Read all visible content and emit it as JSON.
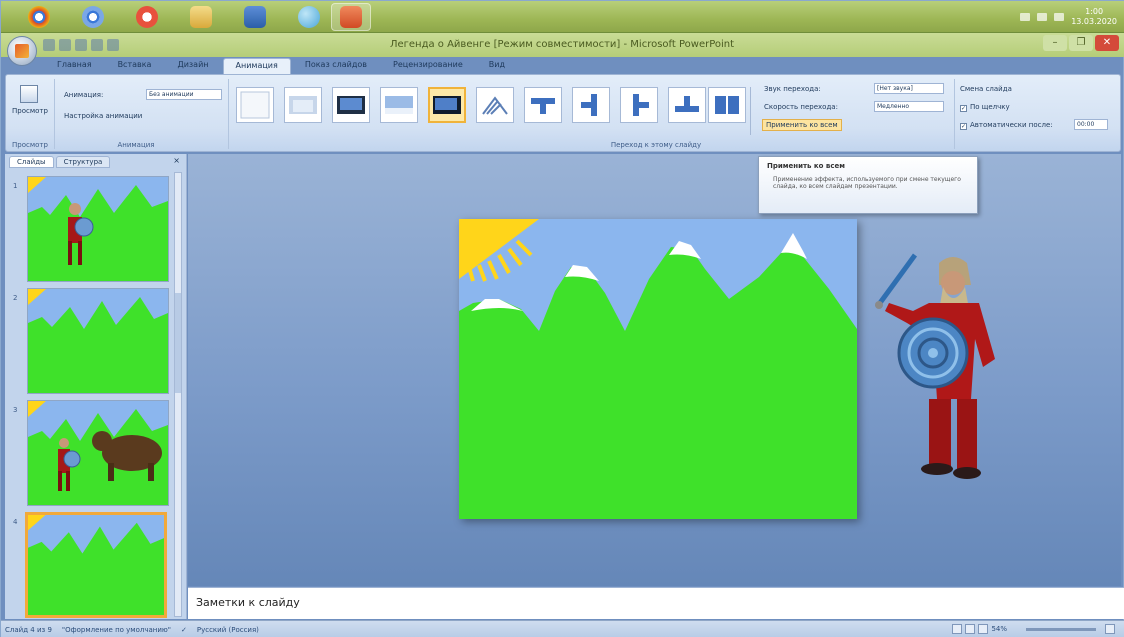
{
  "taskbar": {
    "apps": [
      {
        "name": "chrome-icon",
        "color": "#d9472b"
      },
      {
        "name": "chromium-icon",
        "color": "#3a78d8"
      },
      {
        "name": "media-icon",
        "color": "#e8513d"
      },
      {
        "name": "folder-icon",
        "color": "#e6c35c"
      },
      {
        "name": "word-icon",
        "color": "#2b5fa8"
      },
      {
        "name": "globe-icon",
        "color": "#4aa6d8"
      },
      {
        "name": "powerpoint-icon",
        "color": "#d14a24"
      }
    ],
    "time": "1:00",
    "date": "13.03.2020"
  },
  "window": {
    "title": "Легенда о Айвенге [Режим совместимости] - Microsoft PowerPoint",
    "min_label": "–",
    "max_label": "❐",
    "close_label": "✕"
  },
  "ribbon": {
    "tabs": [
      "Главная",
      "Вставка",
      "Дизайн",
      "Анимация",
      "Показ слайдов",
      "Рецензирование",
      "Вид"
    ],
    "active_tab": "Анимация",
    "preview_group": {
      "button": "Просмотр",
      "label": "Просмотр"
    },
    "animation_group": {
      "animate_label": "Анимация:",
      "animate_value": "Без анимации",
      "custom_button": "Настройка анимации",
      "label": "Анимация"
    },
    "transitions_label": "Переход к этому слайду",
    "sound_label": "Звук перехода:",
    "sound_value": "[Нет звука]",
    "speed_label": "Скорость перехода:",
    "speed_value": "Медленно",
    "apply_all": "Применить ко всем",
    "advance_title": "Смена слайда",
    "on_click": "По щелчку",
    "auto_after": "Автоматически после:",
    "auto_time": "00:00"
  },
  "tooltip": {
    "title": "Применить ко всем",
    "body": "Применение эффекта, используемого при смене текущего слайда, ко всем слайдам презентации."
  },
  "pane": {
    "tabs": [
      "Слайды",
      "Структура"
    ],
    "close": "×",
    "slide_numbers": [
      "1",
      "2",
      "3",
      "4"
    ]
  },
  "notes": {
    "placeholder": "Заметки к слайду"
  },
  "status": {
    "slide": "Слайд 4 из 9",
    "theme": "\"Оформление по умолчанию\"",
    "language": "Русский (Россия)",
    "zoom": "54%"
  },
  "colors": {
    "grass": "#3fe12a",
    "sky": "#8bb6ee",
    "sun": "#ffd51a",
    "warrior": "#b01818"
  }
}
